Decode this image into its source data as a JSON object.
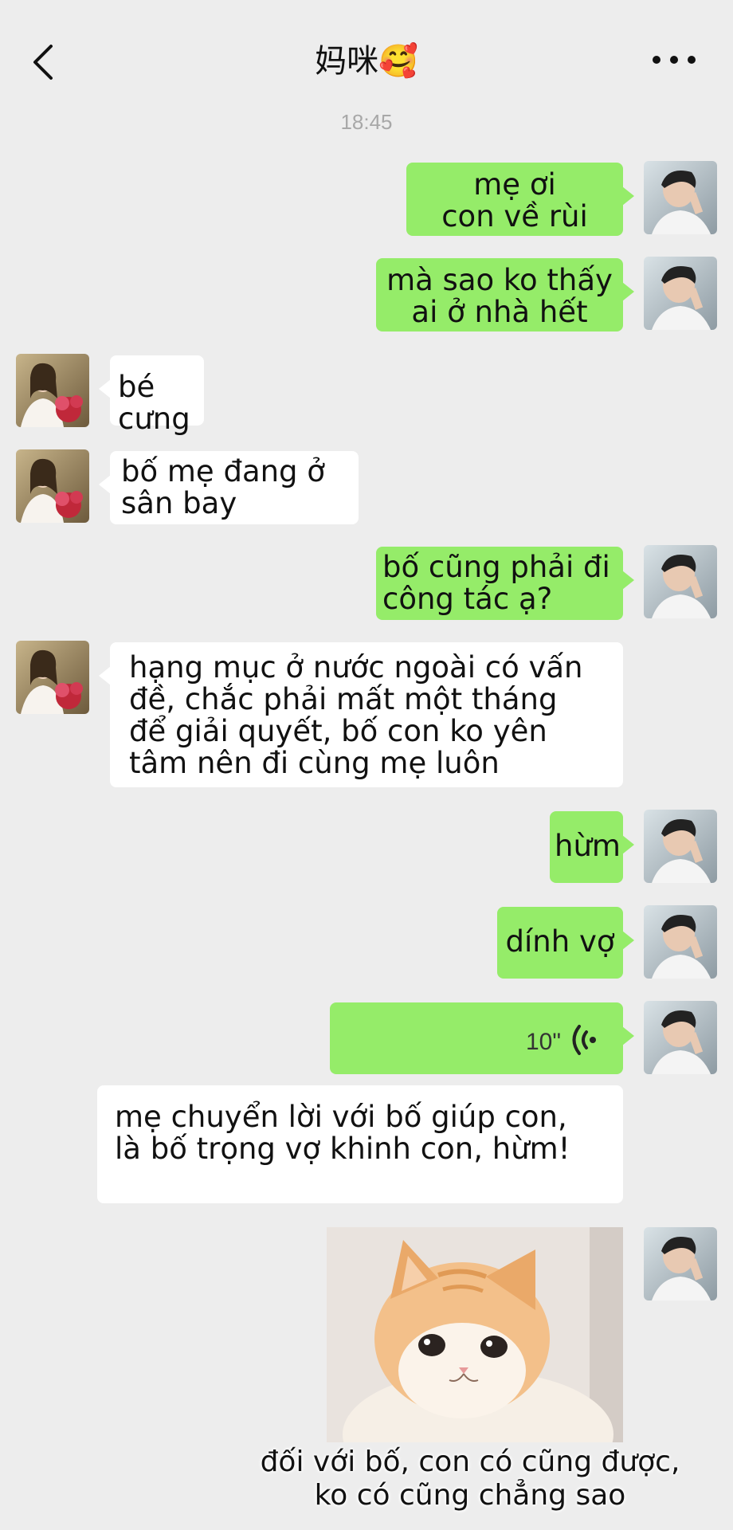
{
  "header": {
    "title": "妈咪🥰",
    "back_icon": "chevron-left-icon",
    "more_icon": "ellipsis-icon"
  },
  "timestamp": "18:45",
  "messages": [
    {
      "from": "me",
      "text": "mẹ ơi\ncon về rùi"
    },
    {
      "from": "me",
      "text": "mà sao ko thấy\nai ở nhà hết"
    },
    {
      "from": "mom",
      "text": "bé cưng"
    },
    {
      "from": "mom",
      "text": "bố mẹ đang ở\nsân bay"
    },
    {
      "from": "me",
      "text": "bố cũng phải đi\ncông tác ạ?"
    },
    {
      "from": "mom",
      "text": "hạng mục ở nước ngoài có vấn\nđề, chắc phải mất một tháng\nđể giải quyết, bố con ko yên\ntâm nên đi cùng mẹ luôn"
    },
    {
      "from": "me",
      "text": "hừm"
    },
    {
      "from": "me",
      "text": "dính vợ"
    },
    {
      "from": "me",
      "type": "voice",
      "duration": "10\""
    },
    {
      "from": "me",
      "text": "mẹ chuyển lời với bố giúp con,\nlà bố trọng vợ khinh con, hừm!"
    },
    {
      "from": "me",
      "type": "sticker",
      "caption": "đối với bố, con có cũng được,\nko có cũng chẳng sao"
    }
  ],
  "colors": {
    "background": "#ededed",
    "sent_bubble": "#95ec69",
    "received_bubble": "#ffffff"
  }
}
